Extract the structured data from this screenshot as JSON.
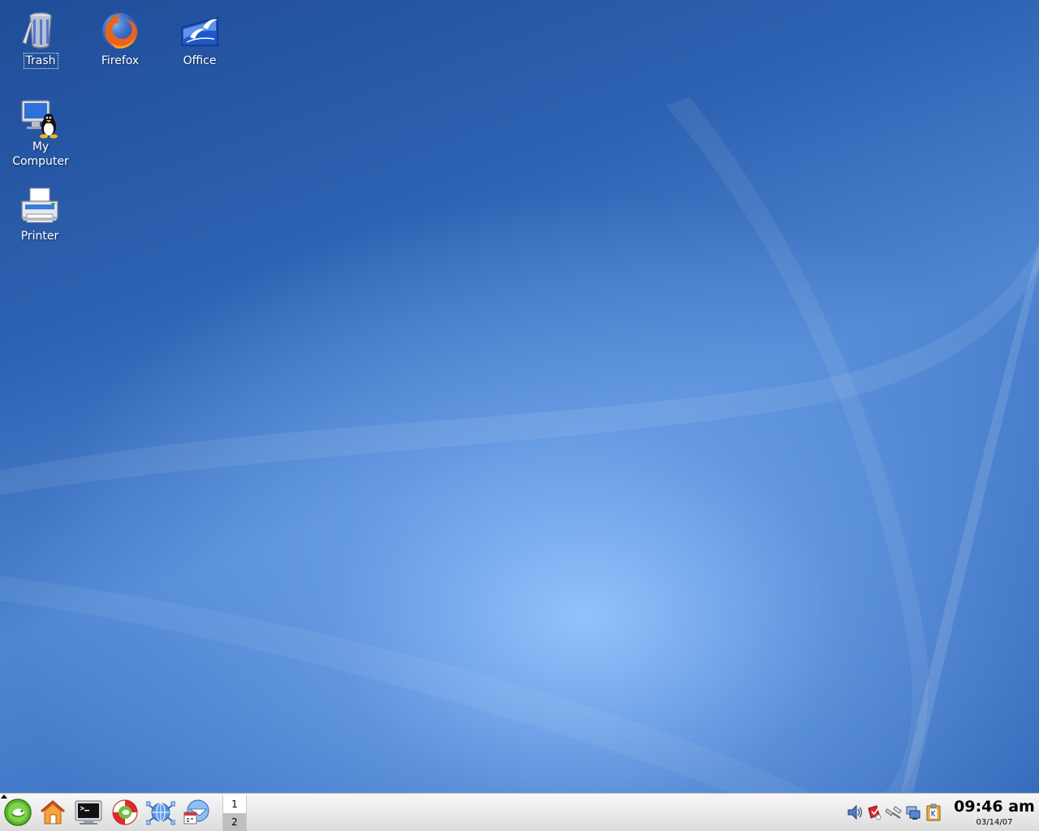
{
  "desktop": {
    "icons": [
      {
        "label": "Trash"
      },
      {
        "label": "Firefox"
      },
      {
        "label": "Office"
      },
      {
        "label": "My Computer"
      },
      {
        "label": "Printer"
      }
    ]
  },
  "taskbar": {
    "launchers": [
      "suse-menu-icon",
      "home-folder-icon",
      "terminal-icon",
      "help-lifebuoy-icon",
      "network-browser-icon",
      "calendar-organizer-icon"
    ],
    "pager": {
      "desktops": [
        "1",
        "2"
      ],
      "active": "1"
    },
    "tray": [
      "volume-icon",
      "update-notifier-icon",
      "network-cable-icon",
      "network-status-icon",
      "clipboard-klipper-icon"
    ],
    "clock": {
      "time": "09:46 am",
      "date": "03/14/07"
    }
  },
  "colors": {
    "wallpaper_dark": "#1f4d99",
    "wallpaper_light": "#96c6ff",
    "panel": "#ececec"
  }
}
